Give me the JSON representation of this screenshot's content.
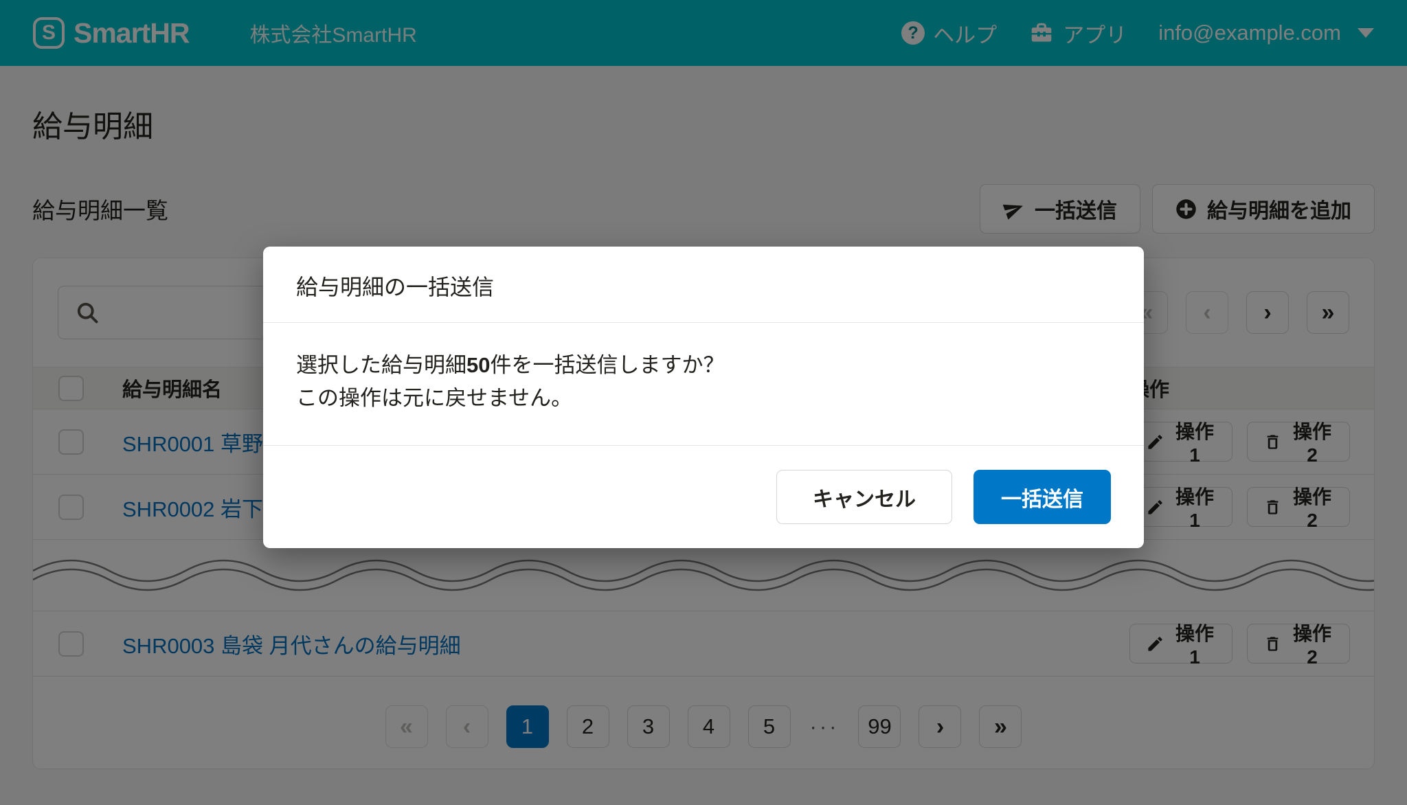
{
  "header": {
    "logo_glyph": "S",
    "logo_text": "SmartHR",
    "company": "株式会社SmartHR",
    "help_icon": "?",
    "help_label": "ヘルプ",
    "apps_label": "アプリ",
    "account_email": "info@example.com"
  },
  "page": {
    "title": "給与明細",
    "section_title": "給与明細一覧",
    "bulk_send_button": "一括送信",
    "add_button": "給与明細を追加"
  },
  "toolbar": {
    "search_value": ""
  },
  "table": {
    "columns": {
      "name": "給与明細名",
      "actions": "操作"
    },
    "rows": [
      {
        "name": "SHR0001 草野"
      },
      {
        "name": "SHR0002 岩下"
      },
      {
        "name": "SHR0003 島袋 月代さんの給与明細"
      }
    ],
    "row_action1": "操作1",
    "row_action2": "操作2"
  },
  "pagination": {
    "first": "«",
    "prev": "‹",
    "next": "›",
    "last": "»",
    "pages": [
      "1",
      "2",
      "3",
      "4",
      "5"
    ],
    "current_page": "1",
    "ellipsis": "···",
    "last_page": "99"
  },
  "modal": {
    "title": "給与明細の一括送信",
    "body_pre": "選択した給与明細",
    "body_count": "50",
    "body_post": "件を一括送信しますか？",
    "body_line2": "この操作は元に戻せません。",
    "cancel_label": "キャンセル",
    "confirm_label": "一括送信"
  },
  "colors": {
    "brand_teal": "#00c4cc",
    "primary_blue": "#0077c7",
    "link_blue": "#0071c1",
    "scrim": "rgba(0,0,0,0.5)"
  }
}
